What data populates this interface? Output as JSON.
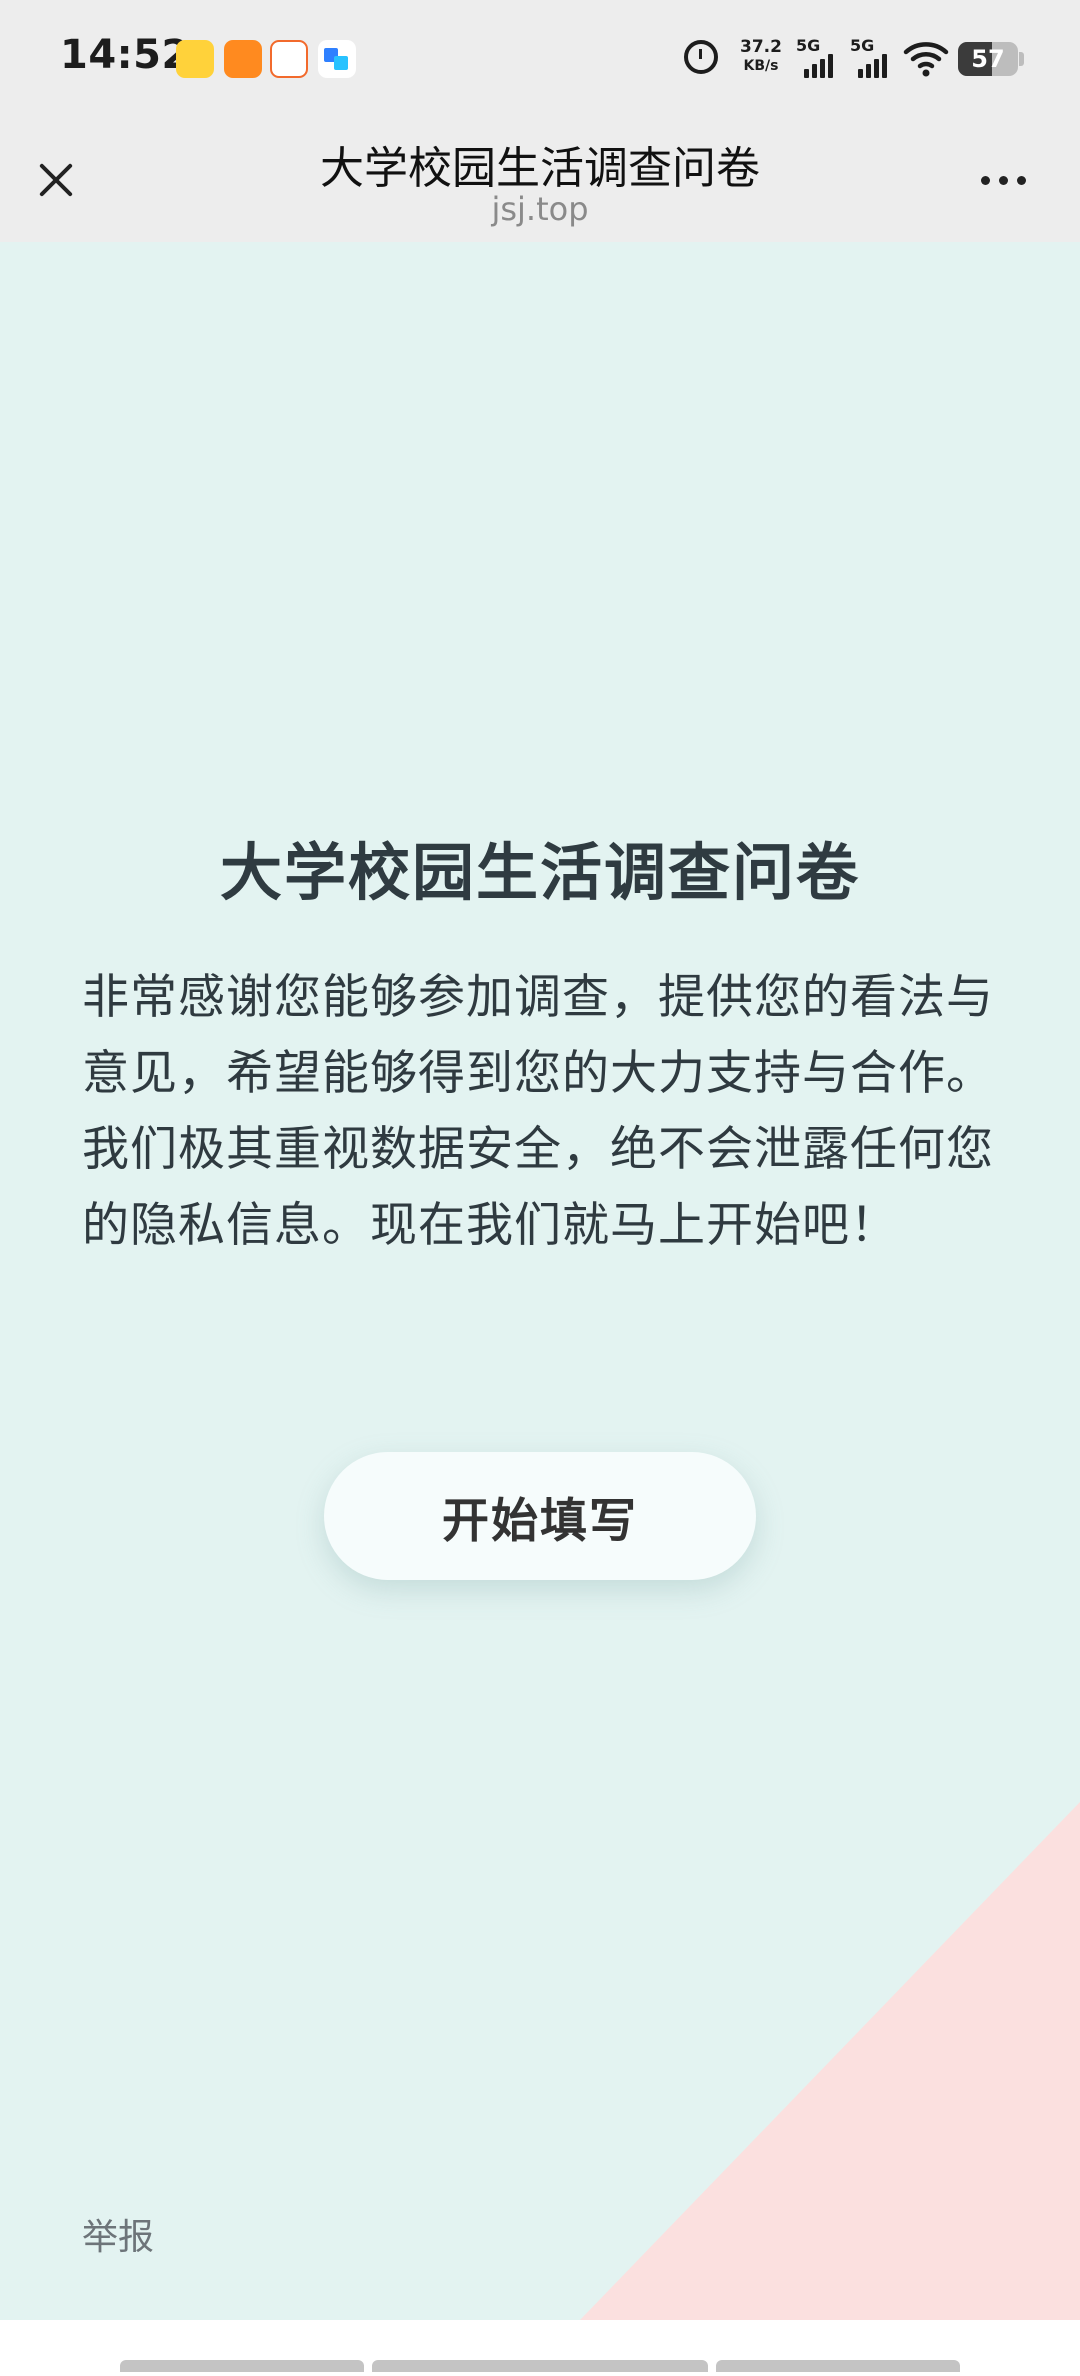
{
  "status_bar": {
    "time": "14:52",
    "app_icons": [
      "yellow-app-icon",
      "video-app-icon",
      "orange-app-icon",
      "blue-app-icon"
    ],
    "alarm_icon": "alarm-clock-icon",
    "net_speed_value": "37.2",
    "net_speed_unit": "KB/s",
    "signal_1_label": "5G",
    "signal_2_label": "5G",
    "wifi_icon": "wifi-icon",
    "battery_level": "57",
    "battery_fraction": 0.57
  },
  "title_bar": {
    "close_icon": "close-icon",
    "title": "大学校园生活调查问卷",
    "domain": "jsj.top",
    "more_icon": "more-icon"
  },
  "main": {
    "survey_title": "大学校园生活调查问卷",
    "survey_intro": "非常感谢您能够参加调查，提供您的看法与意见，希望能够得到您的大力支持与合作。我们极其重视数据安全，绝不会泄露任何您的隐私信息。现在我们就马上开始吧！",
    "start_button_label": "开始填写",
    "report_link_label": "举报"
  },
  "colors": {
    "status_bar_bg": "#ededed",
    "content_bg": "#e3f3f1",
    "corner_accent": "#fbe0df",
    "title_text": "#2f3b41",
    "button_bg": "#f6fcfc"
  }
}
